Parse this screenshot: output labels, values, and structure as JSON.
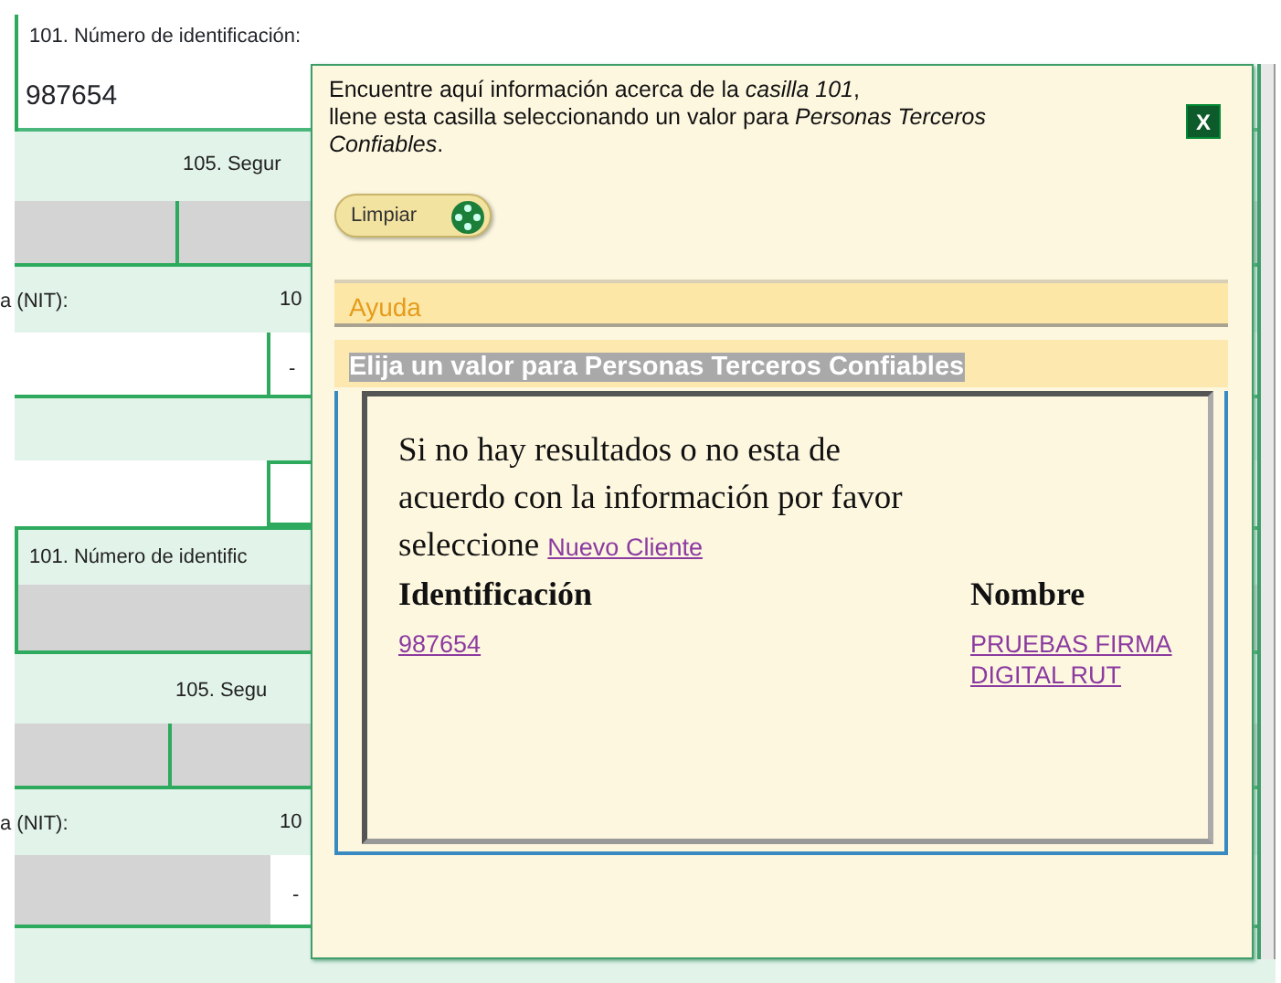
{
  "form": {
    "top_label": "101. Número de identificación:",
    "top_value": "987654",
    "rows": [
      {
        "kind": "label",
        "texts": [
          "105. Segur"
        ]
      },
      {
        "kind": "grey"
      },
      {
        "kind": "nit",
        "texts": [
          "a (NIT):",
          "10"
        ]
      },
      {
        "kind": "dash",
        "texts": [
          "-"
        ]
      },
      {
        "kind": "blank"
      },
      {
        "kind": "white"
      },
      {
        "kind": "box",
        "texts": [
          "101. Número de identific"
        ]
      },
      {
        "kind": "label",
        "texts": [
          "105. Segu"
        ]
      },
      {
        "kind": "grey"
      },
      {
        "kind": "nit",
        "texts": [
          "a (NIT):",
          "10"
        ]
      },
      {
        "kind": "greydash",
        "texts": [
          "-"
        ]
      },
      {
        "kind": "blank"
      }
    ]
  },
  "popup": {
    "intro": "Encuentre aquí información acerca de la *casilla 101*,\nllene esta casilla seleccionando un valor para *Personas Terceros Confiables*.",
    "close": "X",
    "clear_button": "Limpiar",
    "help_title": "Ayuda",
    "choose_title": "Elija un valor para Personas Terceros Confiables",
    "message": "Si no hay resultados o no esta de acuerdo con la información por favor seleccione",
    "new_client_link": "Nuevo Cliente",
    "columns": [
      "Identificación",
      "Nombre"
    ],
    "results": [
      {
        "id": "987654",
        "name": "PRUEBAS FIRMA DIGITAL RUT"
      }
    ]
  }
}
